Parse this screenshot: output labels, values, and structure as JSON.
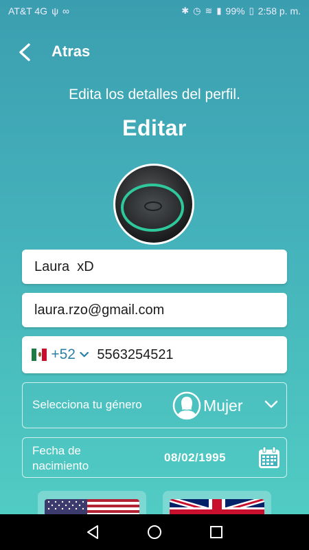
{
  "status_bar": {
    "carrier": "AT&T 4G",
    "battery": "99%",
    "time": "2:58 p. m."
  },
  "header": {
    "back_label": "Atras"
  },
  "subtitle": "Edita los detalles del perfil.",
  "title": "Editar",
  "form": {
    "name_value": "Laura  xD",
    "email_value": "laura.rzo@gmail.com",
    "phone_code": "+52",
    "phone_number": "5563254521",
    "gender_label": "Selecciona tu género",
    "gender_value": "Mujer",
    "date_label": "Fecha de nacimiento",
    "date_value": "08/02/1995"
  },
  "languages": [
    {
      "icon": "flag-usa-icon"
    },
    {
      "icon": "flag-uk-icon"
    }
  ],
  "colors": {
    "accent": "#2d7fa8",
    "bg_top": "#3b9eb0",
    "bg_bottom": "#52cfc4"
  }
}
